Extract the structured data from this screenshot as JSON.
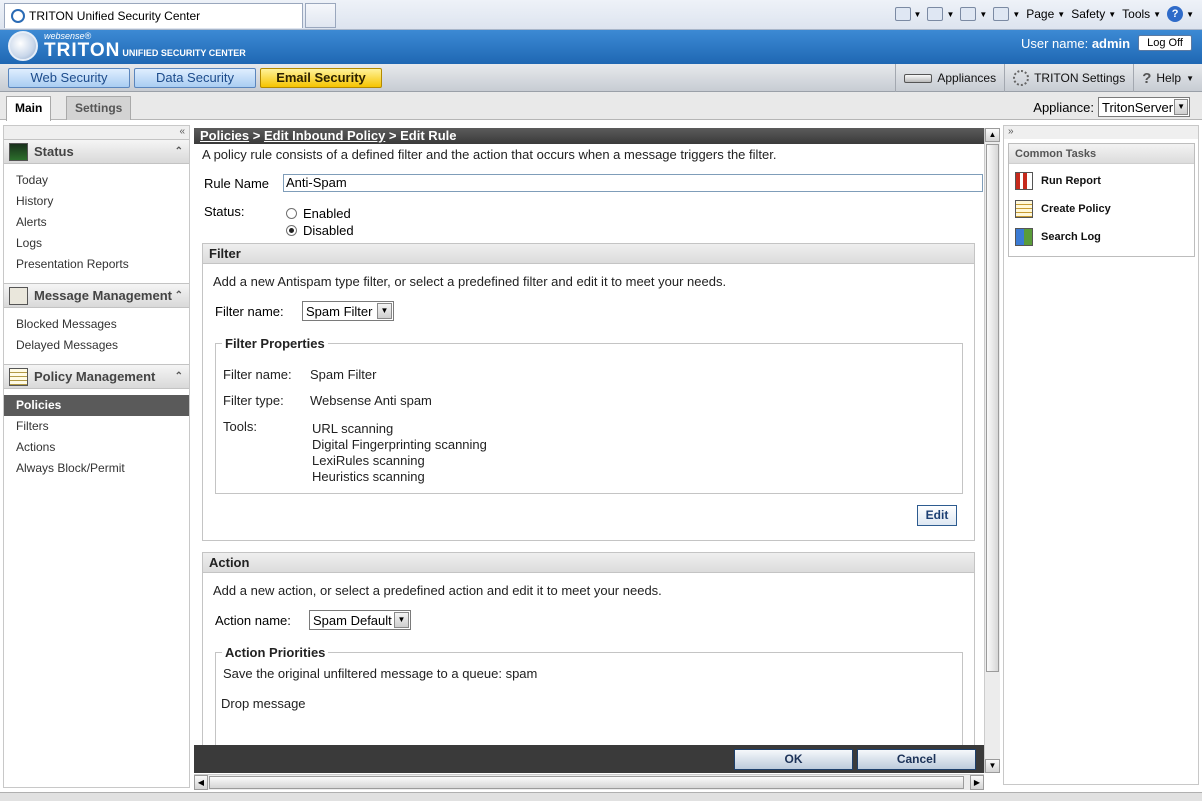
{
  "browser": {
    "tab_title": "TRITON Unified Security Center",
    "commands": [
      "Page",
      "Safety",
      "Tools"
    ]
  },
  "header": {
    "logo_sub": "websense®",
    "logo_main": "TRITON",
    "logo_tag": "UNIFIED SECURITY CENTER",
    "user_label": "User name:",
    "user_name": "admin",
    "logoff_label": "Log Off"
  },
  "modules": {
    "web": "Web Security",
    "data": "Data Security",
    "email": "Email Security",
    "active_color": "#f6c400"
  },
  "toolbar": {
    "appliances": "Appliances",
    "triton_settings": "TRITON Settings",
    "help": "Help"
  },
  "tabs": {
    "main": "Main",
    "settings": "Settings"
  },
  "appliance": {
    "label": "Appliance:",
    "value": "TritonServer"
  },
  "nav": {
    "status": {
      "title": "Status",
      "items": [
        "Today",
        "History",
        "Alerts",
        "Logs",
        "Presentation Reports"
      ]
    },
    "message": {
      "title": "Message Management",
      "items": [
        "Blocked Messages",
        "Delayed Messages"
      ]
    },
    "policy": {
      "title": "Policy Management",
      "items": [
        "Policies",
        "Filters",
        "Actions",
        "Always Block/Permit"
      ],
      "active": "Policies"
    }
  },
  "breadcrumb": {
    "policies": "Policies",
    "sep1": " > ",
    "inbound": "Edit Inbound Policy",
    "sep2": " > ",
    "current": "Edit Rule"
  },
  "intro": "A policy rule consists of a defined filter and the action that occurs when a message triggers the filter.",
  "rule": {
    "name_label": "Rule Name",
    "name_value": "Anti-Spam",
    "status_label": "Status:",
    "enabled": "Enabled",
    "disabled": "Disabled",
    "selected": "Disabled"
  },
  "filter": {
    "title": "Filter",
    "desc": "Add a new Antispam type filter, or select a predefined filter and edit it to meet your needs.",
    "name_label": "Filter name:",
    "name_value": "Spam Filter",
    "props_title": "Filter Properties",
    "prop_name_label": "Filter name:",
    "prop_name_value": "Spam Filter",
    "prop_type_label": "Filter type:",
    "prop_type_value": "Websense Anti spam",
    "tools_label": "Tools:",
    "tools": [
      "URL scanning",
      "Digital Fingerprinting scanning",
      "LexiRules scanning",
      "Heuristics scanning"
    ],
    "edit_label": "Edit"
  },
  "action": {
    "title": "Action",
    "desc": "Add a new action, or select a predefined action and edit it to meet your needs.",
    "name_label": "Action name:",
    "name_value": "Spam Default",
    "priorities_title": "Action Priorities",
    "priorities": [
      "Save the original unfiltered message to a queue: spam",
      "Drop message"
    ]
  },
  "footer": {
    "ok": "OK",
    "cancel": "Cancel"
  },
  "common_tasks": {
    "title": "Common Tasks",
    "items": [
      "Run Report",
      "Create Policy",
      "Search Log"
    ]
  }
}
